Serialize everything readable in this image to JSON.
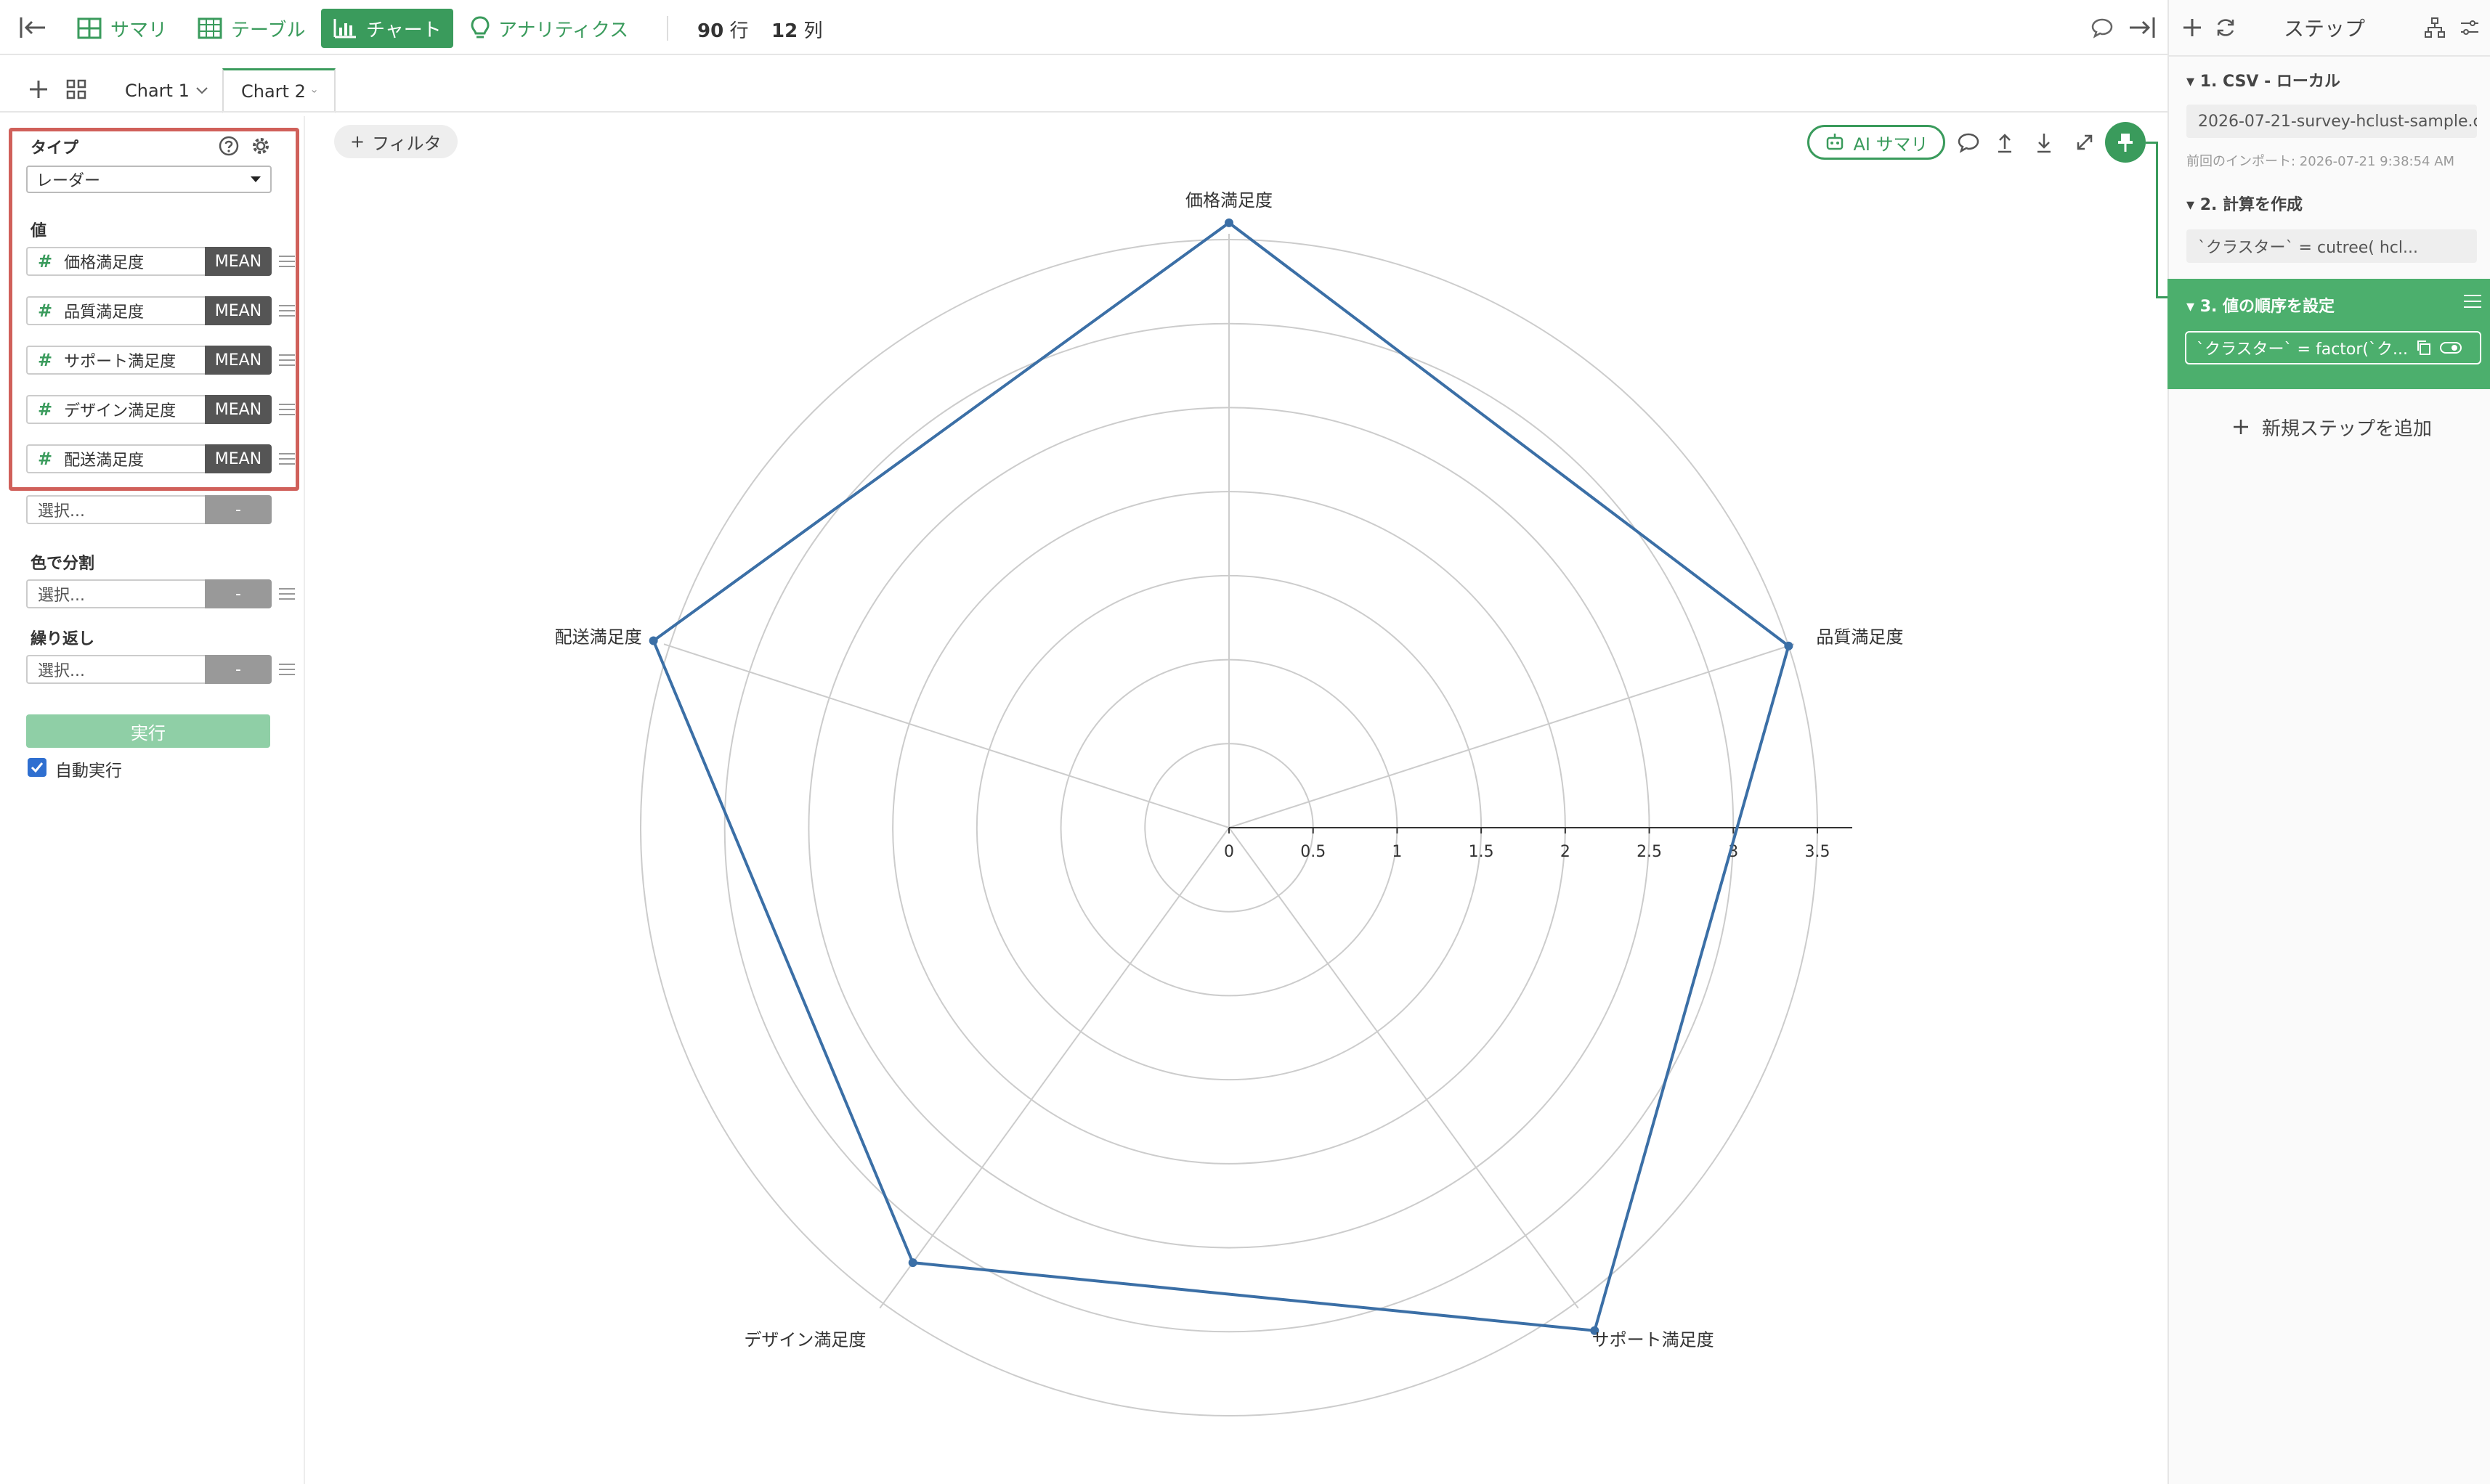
{
  "toolbar": {
    "nav": [
      {
        "label": "サマリ",
        "icon": "summary-grid-icon"
      },
      {
        "label": "テーブル",
        "icon": "table-icon"
      },
      {
        "label": "チャート",
        "icon": "bar-chart-icon",
        "active": true
      },
      {
        "label": "アナリティクス",
        "icon": "lightbulb-icon"
      }
    ],
    "rows_count": "90",
    "rows_unit": "行",
    "cols_count": "12",
    "cols_unit": "列"
  },
  "tabs": [
    {
      "label": "Chart 1",
      "active": false
    },
    {
      "label": "Chart 2",
      "active": true
    }
  ],
  "config": {
    "type_label": "タイプ",
    "type_value": "レーダー",
    "values_label": "値",
    "values": [
      {
        "name": "価格満足度",
        "agg": "MEAN"
      },
      {
        "name": "品質満足度",
        "agg": "MEAN"
      },
      {
        "name": "サポート満足度",
        "agg": "MEAN"
      },
      {
        "name": "デザイン満足度",
        "agg": "MEAN"
      },
      {
        "name": "配送満足度",
        "agg": "MEAN"
      }
    ],
    "value_placeholder": "選択...",
    "empty_agg": "-",
    "color_label": "色で分割",
    "color_placeholder": "選択...",
    "repeat_label": "繰り返し",
    "repeat_placeholder": "選択...",
    "run_label": "実行",
    "auto_run_label": "自動実行",
    "auto_run_checked": true
  },
  "chart_toolbar": {
    "filter_label": "フィルタ",
    "ai_summary_label": "AI サマリ"
  },
  "chart_data": {
    "type": "radar",
    "axes": [
      "価格満足度",
      "品質満足度",
      "サポート満足度",
      "デザイン満足度",
      "配送満足度"
    ],
    "values": [
      3.6,
      3.5,
      3.7,
      3.2,
      3.6
    ],
    "rmax": 3.5,
    "ticks": [
      0,
      0.5,
      1,
      1.5,
      2,
      2.5,
      3,
      3.5
    ],
    "grid": true,
    "line_color": "#3b6fa6"
  },
  "steps": {
    "header": "ステップ",
    "items": [
      {
        "title": "1. CSV - ローカル",
        "content": "2026-07-21-survey-hclust-sample.c...",
        "note": "前回のインポート: 2026-07-21 9:38:54 AM"
      },
      {
        "title": "2. 計算を作成",
        "content": "`クラスター` = cutree( hcl..."
      },
      {
        "title": "3. 値の順序を設定",
        "content": "`クラスター` = factor(`ク...",
        "active": true
      }
    ],
    "add_step_label": "新規ステップを追加"
  }
}
